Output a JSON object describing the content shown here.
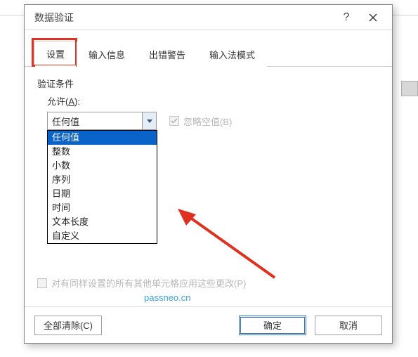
{
  "dialog": {
    "title": "数据验证",
    "help_tooltip": "?",
    "tabs": [
      {
        "label": "设置",
        "active": true
      },
      {
        "label": "输入信息",
        "active": false
      },
      {
        "label": "出错警告",
        "active": false
      },
      {
        "label": "输入法模式",
        "active": false
      }
    ],
    "group_label": "验证条件",
    "allow_label_prefix": "允许(",
    "allow_label_accel": "A",
    "allow_label_suffix": "):",
    "allow_selected": "任何值",
    "allow_options": [
      "任何值",
      "整数",
      "小数",
      "序列",
      "日期",
      "时间",
      "文本长度",
      "自定义"
    ],
    "ignore_blank_label": "忽略空值(B)",
    "ignore_blank_checked": true,
    "ignore_blank_disabled": true,
    "apply_all_label": "对有同样设置的所有其他单元格应用这些更改(P)",
    "apply_all_checked": false,
    "apply_all_disabled": true,
    "buttons": {
      "clear_all": "全部清除(C)",
      "ok": "确定",
      "cancel": "取消"
    }
  },
  "watermark": "passneo.cn"
}
